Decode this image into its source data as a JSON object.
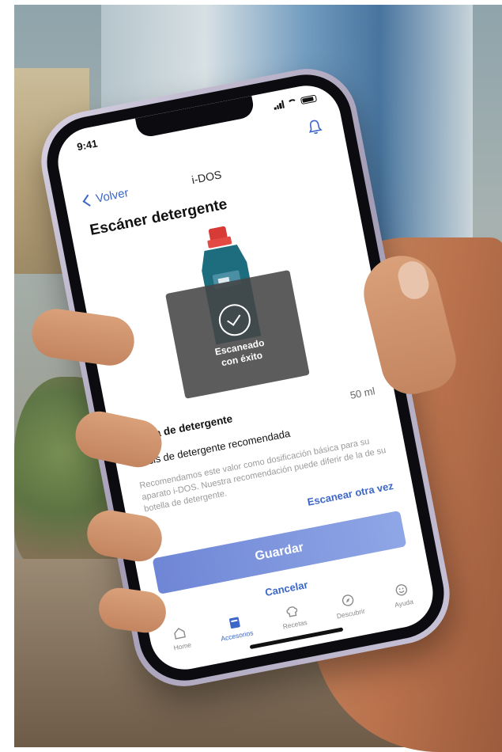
{
  "status_bar": {
    "time": "9:41"
  },
  "nav": {
    "back_label": "Volver",
    "title": "i-DOS"
  },
  "page": {
    "title": "Escáner detergente"
  },
  "scan": {
    "result_line1": "Escaneado",
    "result_line2": "con éxito"
  },
  "details": {
    "brand_label": "Marca de detergente",
    "dose_value": "50 ml",
    "dose_label": "Dosis de detergente recomendada",
    "dose_note": "Recomendamos este valor como dosificación básica para su aparato i-DOS. Nuestra recomendación puede diferir de la de su botella de detergente.",
    "rescan_label": "Escanear otra vez"
  },
  "actions": {
    "save_label": "Guardar",
    "cancel_label": "Cancelar"
  },
  "tabbar": {
    "items": [
      {
        "label": "Home",
        "icon": "home-icon",
        "active": false
      },
      {
        "label": "Accesorios",
        "icon": "detergent-box-icon",
        "active": true
      },
      {
        "label": "Recetas",
        "icon": "chef-hat-icon",
        "active": false
      },
      {
        "label": "Descubrir",
        "icon": "compass-icon",
        "active": false
      },
      {
        "label": "Ayuda",
        "icon": "smiley-icon",
        "active": false
      }
    ]
  },
  "colors": {
    "accent": "#3c67c9",
    "save_button": "#7d95dd",
    "overlay": "#464646"
  }
}
